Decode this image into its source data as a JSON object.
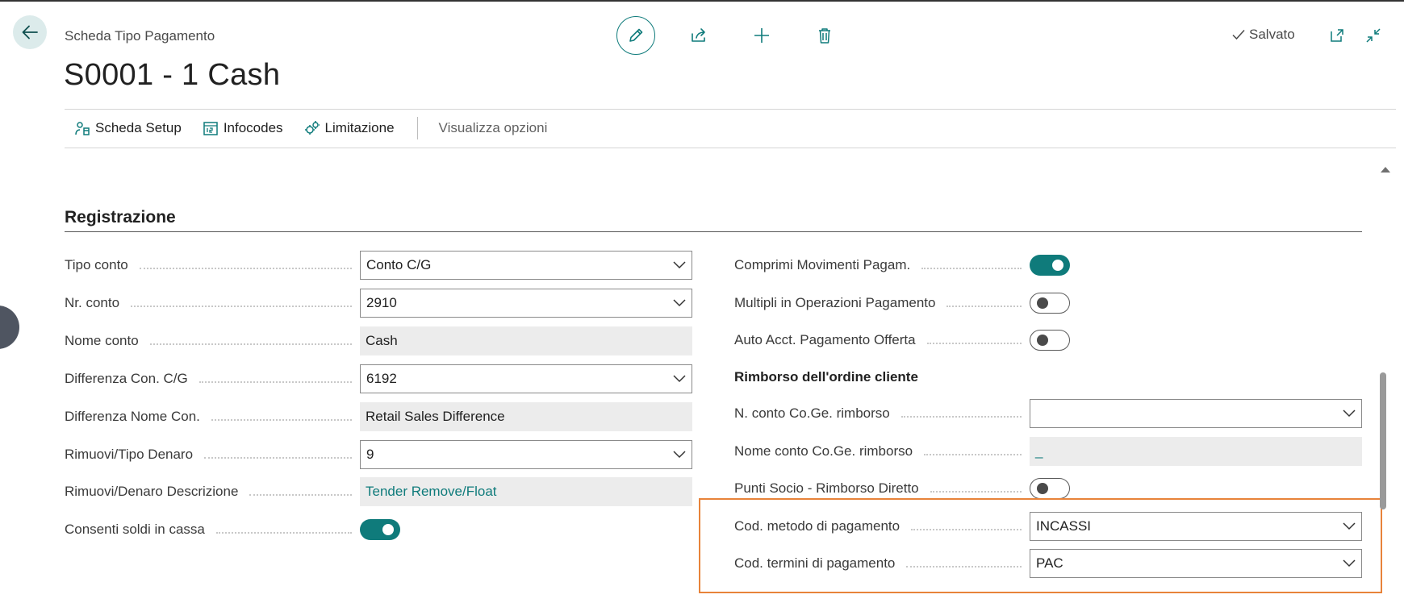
{
  "header": {
    "breadcrumb": "Scheda Tipo Pagamento",
    "title": "S0001 - 1 Cash",
    "saved_label": "Salvato"
  },
  "toolbar_icons": [
    "edit-icon",
    "share-icon",
    "add-icon",
    "delete-icon"
  ],
  "actionbar": {
    "items": [
      {
        "label": "Scheda Setup",
        "icon": "setup-icon"
      },
      {
        "label": "Infocodes",
        "icon": "infocodes-icon"
      },
      {
        "label": "Limitazione",
        "icon": "limitation-icon"
      }
    ],
    "options_label": "Visualizza opzioni"
  },
  "section": {
    "title": "Registrazione",
    "left_fields": [
      {
        "label": "Tipo conto",
        "value": "Conto C/G",
        "kind": "select"
      },
      {
        "label": "Nr. conto",
        "value": "2910",
        "kind": "select"
      },
      {
        "label": "Nome conto",
        "value": "Cash",
        "kind": "readonly"
      },
      {
        "label": "Differenza Con. C/G",
        "value": "6192",
        "kind": "select"
      },
      {
        "label": "Differenza Nome Con.",
        "value": "Retail Sales Difference",
        "kind": "readonly"
      },
      {
        "label": "Rimuovi/Tipo Denaro",
        "value": "9",
        "kind": "select"
      },
      {
        "label": "Rimuovi/Denaro Descrizione",
        "value": "Tender Remove/Float",
        "kind": "readonly-link"
      },
      {
        "label": "Consenti soldi in cassa",
        "value": true,
        "kind": "toggle"
      }
    ],
    "right_fields": [
      {
        "label": "Comprimi Movimenti Pagam.",
        "value": true,
        "kind": "toggle"
      },
      {
        "label": "Multipli in Operazioni Pagamento",
        "value": false,
        "kind": "toggle"
      },
      {
        "label": "Auto Acct. Pagamento Offerta",
        "value": false,
        "kind": "toggle"
      }
    ],
    "refund_heading": "Rimborso dell'ordine cliente",
    "refund_fields": [
      {
        "label": "N. conto Co.Ge. rimborso",
        "value": "",
        "kind": "select"
      },
      {
        "label": "Nome conto Co.Ge. rimborso",
        "value": "_",
        "kind": "readonly-link"
      },
      {
        "label": "Punti Socio - Rimborso Diretto",
        "value": false,
        "kind": "toggle"
      },
      {
        "label": "Cod. metodo di pagamento",
        "value": "INCASSI",
        "kind": "select"
      },
      {
        "label": "Cod. termini di pagamento",
        "value": "PAC",
        "kind": "select"
      }
    ]
  },
  "colors": {
    "accent": "#0f7b7b",
    "highlight": "#e8833a"
  }
}
